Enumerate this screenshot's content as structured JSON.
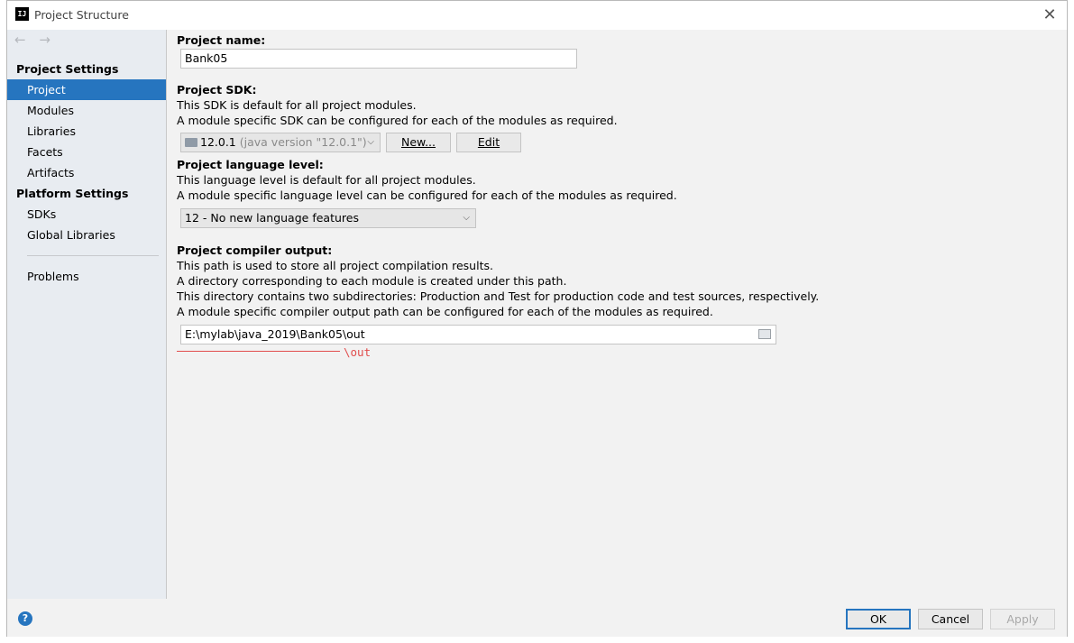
{
  "window": {
    "title": "Project Structure",
    "app_icon_text": "IJ"
  },
  "nav": {
    "back": "←",
    "forward": "→"
  },
  "sidebar": {
    "project_settings_title": "Project Settings",
    "project_settings_items": [
      "Project",
      "Modules",
      "Libraries",
      "Facets",
      "Artifacts"
    ],
    "platform_settings_title": "Platform Settings",
    "platform_settings_items": [
      "SDKs",
      "Global Libraries"
    ],
    "problems": "Problems",
    "selected": "Project"
  },
  "content": {
    "project_name_label": "Project name:",
    "project_name_value": "Bank05",
    "sdk_label": "Project SDK:",
    "sdk_desc1": "This SDK is default for all project modules.",
    "sdk_desc2": "A module specific SDK can be configured for each of the modules as required.",
    "sdk_value": "12.0.1",
    "sdk_version": "(java version \"12.0.1\")",
    "sdk_new_button": "New...",
    "sdk_edit_button": "Edit",
    "lang_label": "Project language level:",
    "lang_desc1": "This language level is default for all project modules.",
    "lang_desc2": "A module specific language level can be configured for each of the modules as required.",
    "lang_value": "12 - No new language features",
    "output_label": "Project compiler output:",
    "output_desc1": "This path is used to store all project compilation results.",
    "output_desc2": "A directory corresponding to each module is created under this path.",
    "output_desc3": "This directory contains two subdirectories: Production and Test for production code and test sources, respectively.",
    "output_desc4": "A module specific compiler output path can be configured for each of the modules as required.",
    "output_value": "E:\\mylab\\java_2019\\Bank05\\out",
    "annotation": "\\out"
  },
  "buttons": {
    "help": "?",
    "ok": "OK",
    "cancel": "Cancel",
    "apply": "Apply"
  },
  "colors": {
    "accent": "#2675bf",
    "annotation": "#e14d4d"
  }
}
